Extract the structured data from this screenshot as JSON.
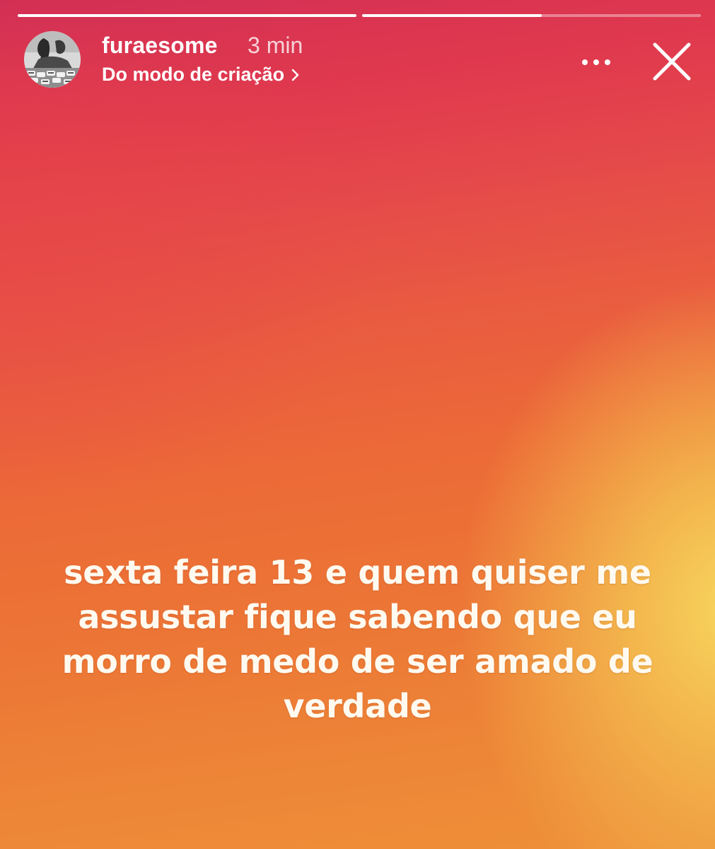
{
  "story": {
    "progress": [
      1.0,
      0.53
    ],
    "user": {
      "username": "furaesome",
      "time_ago": "3 min",
      "source_label": "Do modo de criação",
      "avatar_icon": "profile-photo-avatar"
    },
    "actions": {
      "more_icon": "more-options-icon",
      "close_icon": "close-icon"
    },
    "caption_lines": [
      "sexta feira 13 e quem quiser me",
      "assustar fique sabendo que eu",
      "morro de medo de ser amado de",
      "verdade"
    ],
    "colors": {
      "gradient_top": "#d22f55",
      "gradient_mid": "#ec6a37",
      "gradient_glow": "#f7d65e",
      "text": "#fffaf0"
    }
  }
}
